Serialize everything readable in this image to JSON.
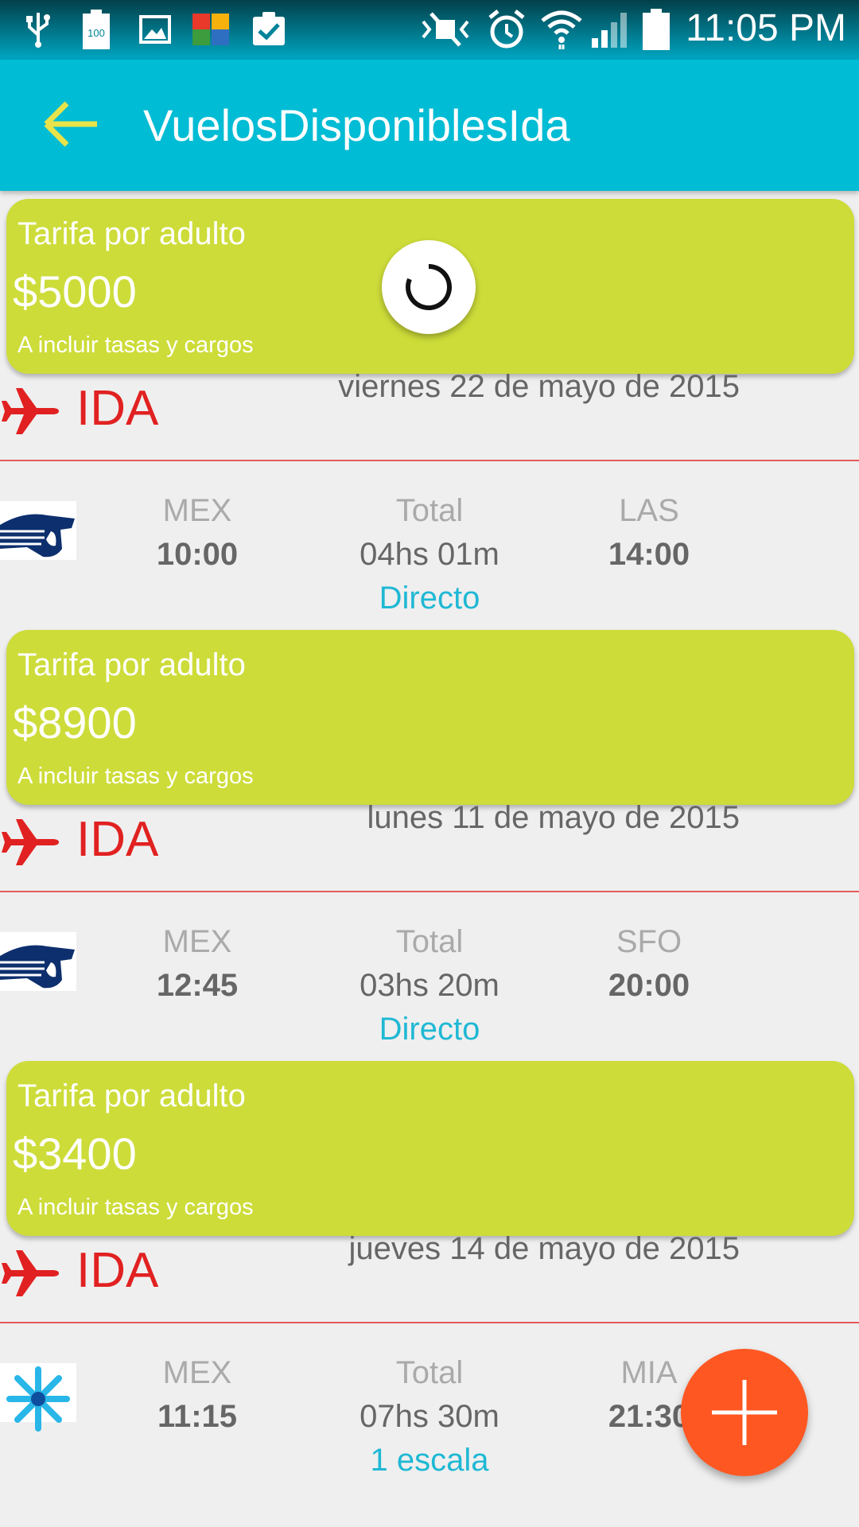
{
  "status_bar": {
    "time": "11:05 PM",
    "battery_level": "100",
    "icons": [
      "usb-icon",
      "battery-icon",
      "image-icon",
      "avg-icon",
      "clipboard-check-icon",
      "mute-icon",
      "alarm-icon",
      "wifi-icon",
      "signal-icon",
      "battery-full-icon"
    ]
  },
  "app_bar": {
    "title": "VuelosDisponiblesIda",
    "back_icon": "arrow-back-icon"
  },
  "colors": {
    "app_bar": "#00bcd4",
    "fare_card": "#cddc39",
    "ida_red": "#e12121",
    "stops_blue": "#1fb8d4",
    "fab": "#ff5722"
  },
  "flights": [
    {
      "fare_label": "Tarifa por adulto",
      "price": "$5000",
      "note": "A incluir tasas y cargos",
      "direction": "IDA",
      "date": "viernes 22 de mayo de 2015",
      "airline_logo": "aeromexico-logo",
      "origin": "MEX",
      "departure": "10:00",
      "total_label": "Total",
      "duration": "04hs 01m",
      "destination": "LAS",
      "arrival": "14:00",
      "stops": "Directo"
    },
    {
      "fare_label": "Tarifa por adulto",
      "price": "$8900",
      "note": "A incluir tasas y cargos",
      "direction": "IDA",
      "date": "lunes 11 de mayo de 2015",
      "airline_logo": "aeromexico-logo",
      "origin": "MEX",
      "departure": "12:45",
      "total_label": "Total",
      "duration": "03hs 20m",
      "destination": "SFO",
      "arrival": "20:00",
      "stops": "Directo"
    },
    {
      "fare_label": "Tarifa por adulto",
      "price": "$3400",
      "note": "A incluir tasas y cargos",
      "direction": "IDA",
      "date": "jueves 14 de mayo de 2015",
      "airline_logo": "interjet-logo",
      "origin": "MEX",
      "departure": "11:15",
      "total_label": "Total",
      "duration": "07hs 30m",
      "destination": "MIA",
      "arrival": "21:30",
      "stops": "1 escala"
    }
  ],
  "fab": {
    "icon": "plus-icon"
  }
}
